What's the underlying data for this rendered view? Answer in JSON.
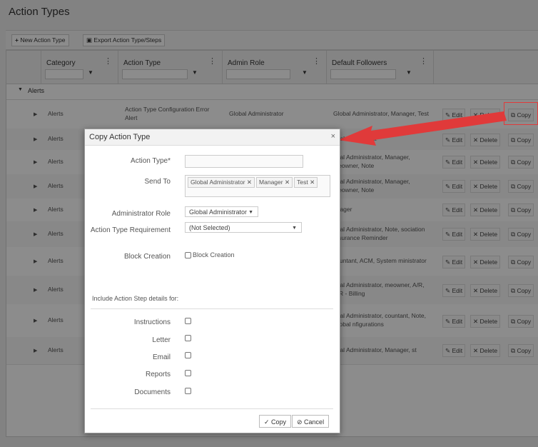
{
  "page": {
    "title": "Action Types"
  },
  "toolbar": {
    "new_label": "New Action Type",
    "export_label": "Export Action Type/Steps"
  },
  "grid": {
    "columns": [
      "Category",
      "Action Type",
      "Admin Role",
      "Default Followers"
    ],
    "group_label": "Alerts",
    "rows": [
      {
        "category": "Alerts",
        "action_type": "Action Type Configuration Error Alert",
        "admin_role": "Global Administrator",
        "followers": "Global Administrator, Manager, Test"
      },
      {
        "category": "Alerts",
        "action_type": "",
        "admin_role": "",
        "followers": "obal Administrat"
      },
      {
        "category": "Alerts",
        "action_type": "",
        "admin_role": "",
        "followers": "obal Administrator, Manager, meowner, Note"
      },
      {
        "category": "Alerts",
        "action_type": "",
        "admin_role": "",
        "followers": "obal Administrator, Manager, meowner, Note"
      },
      {
        "category": "Alerts",
        "action_type": "",
        "admin_role": "",
        "followers": "anager"
      },
      {
        "category": "Alerts",
        "action_type": "",
        "admin_role": "",
        "followers": "obal Administrator, Note, sociation Insurance Reminder"
      },
      {
        "category": "Alerts",
        "action_type": "",
        "admin_role": "",
        "followers": "countant, ACM, System ministrator"
      },
      {
        "category": "Alerts",
        "action_type": "",
        "admin_role": "",
        "followers": "obal Administrator, meowner, A/R, A/R - Billing"
      },
      {
        "category": "Alerts",
        "action_type": "",
        "admin_role": "",
        "followers": "obal Administrator, countant, Note, Global nfigurations"
      },
      {
        "category": "Alerts",
        "action_type": "",
        "admin_role": "",
        "followers": "obal Administrator, Manager, st"
      }
    ],
    "row_actions": {
      "edit": "Edit",
      "delete": "Delete",
      "copy": "Copy"
    }
  },
  "modal": {
    "title": "Copy Action Type",
    "close": "×",
    "fields": {
      "action_type_label": "Action Type*",
      "action_type_value": "",
      "send_to_label": "Send To",
      "send_to_tags": [
        "Global Administrator",
        "Manager",
        "Test"
      ],
      "admin_role_label": "Administrator Role",
      "admin_role_value": "Global Administrator",
      "requirement_label": "Action Type Requirement",
      "requirement_value": "(Not Selected)",
      "block_label": "Block Creation",
      "block_checkbox_label": "Block Creation"
    },
    "include_heading": "Include Action Step details for:",
    "include_items": [
      "Instructions",
      "Letter",
      "Email",
      "Reports",
      "Documents"
    ],
    "copy_button": "Copy",
    "cancel_button": "Cancel"
  },
  "colors": {
    "annotation_red": "#e03a3a",
    "overlay": "rgba(0,0,0,0.45)"
  }
}
